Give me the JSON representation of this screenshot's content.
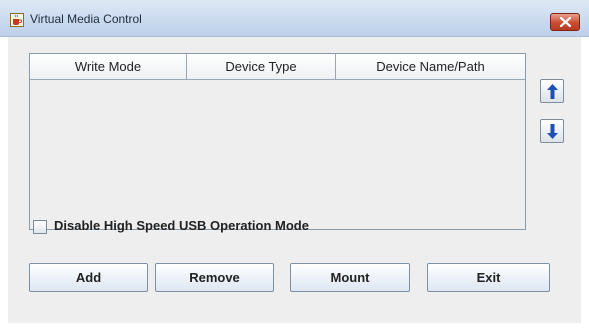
{
  "window": {
    "title": "Virtual Media Control",
    "close_icon": "close-icon",
    "app_icon": "java-cup-icon"
  },
  "table": {
    "columns": [
      "Write Mode",
      "Device Type",
      "Device Name/Path"
    ],
    "rows": []
  },
  "side_buttons": {
    "up_icon": "arrow-up-icon",
    "down_icon": "arrow-down-icon"
  },
  "checkbox": {
    "label": "Disable High Speed USB Operation Mode",
    "checked": false
  },
  "buttons": {
    "add": "Add",
    "remove": "Remove",
    "mount": "Mount",
    "exit": "Exit"
  },
  "colors": {
    "accent_arrow": "#1f4fb4",
    "close_button": "#c94d32"
  }
}
